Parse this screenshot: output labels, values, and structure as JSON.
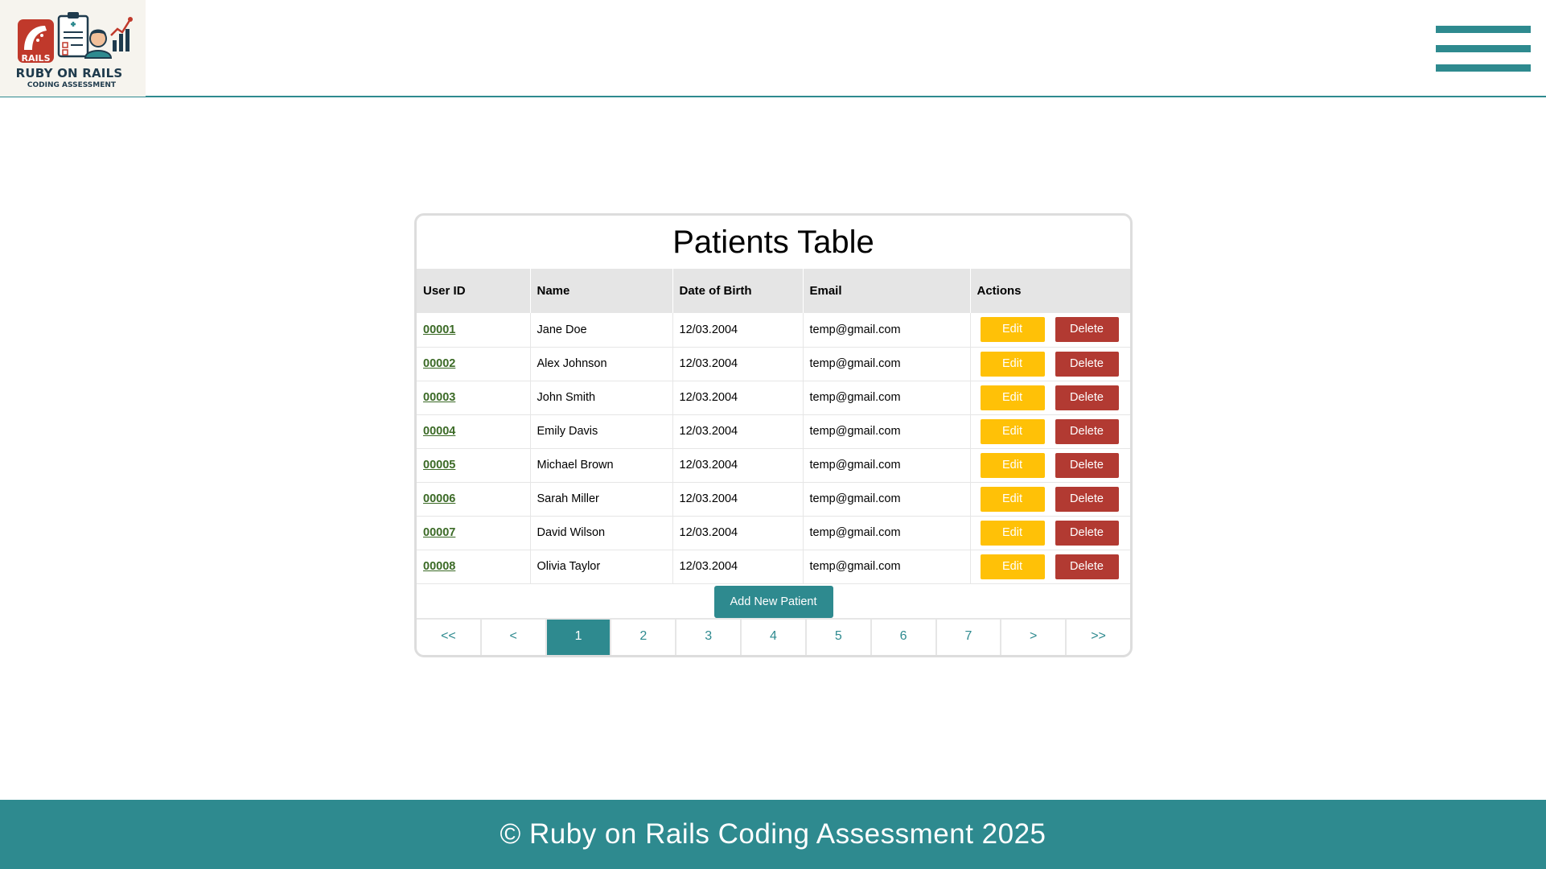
{
  "logo": {
    "badge_text": "RAILS",
    "title": "RUBY ON RAILS",
    "subtitle": "CODING ASSESSMENT"
  },
  "theme": {
    "accent": "#2e8a8f",
    "edit": "#ffc107",
    "delete": "#b23a32"
  },
  "table": {
    "title": "Patients Table",
    "columns": [
      "User ID",
      "Name",
      "Date of Birth",
      "Email",
      "Actions"
    ],
    "rows": [
      {
        "id": "00001",
        "name": "Jane Doe",
        "dob": "12/03.2004",
        "email": "temp@gmail.com"
      },
      {
        "id": "00002",
        "name": "Alex Johnson",
        "dob": "12/03.2004",
        "email": "temp@gmail.com"
      },
      {
        "id": "00003",
        "name": "John Smith",
        "dob": "12/03.2004",
        "email": "temp@gmail.com"
      },
      {
        "id": "00004",
        "name": "Emily Davis",
        "dob": "12/03.2004",
        "email": "temp@gmail.com"
      },
      {
        "id": "00005",
        "name": "Michael Brown",
        "dob": "12/03.2004",
        "email": "temp@gmail.com"
      },
      {
        "id": "00006",
        "name": "Sarah Miller",
        "dob": "12/03.2004",
        "email": "temp@gmail.com"
      },
      {
        "id": "00007",
        "name": "David Wilson",
        "dob": "12/03.2004",
        "email": "temp@gmail.com"
      },
      {
        "id": "00008",
        "name": "Olivia Taylor",
        "dob": "12/03.2004",
        "email": "temp@gmail.com"
      }
    ],
    "edit_label": "Edit",
    "delete_label": "Delete",
    "add_label": "Add New Patient"
  },
  "pagination": {
    "items": [
      "<<",
      "<",
      "1",
      "2",
      "3",
      "4",
      "5",
      "6",
      "7",
      ">",
      ">>"
    ],
    "active": "1"
  },
  "footer": {
    "text": "© Ruby on Rails Coding Assessment 2025"
  }
}
